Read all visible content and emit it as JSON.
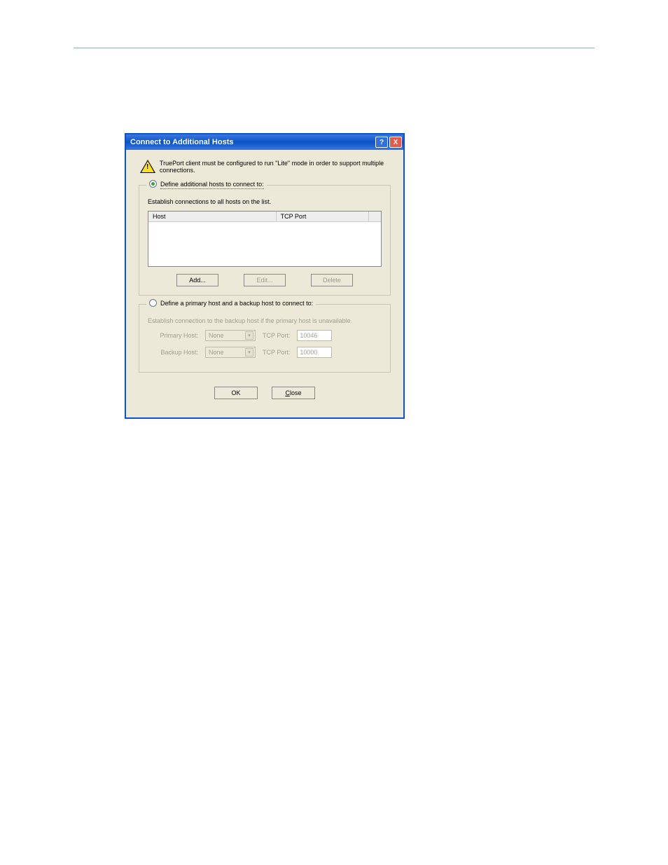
{
  "dialog": {
    "title": "Connect to Additional Hosts",
    "warning": "TruePort client must be configured to run \"Lite\" mode in order to support multiple connections."
  },
  "section1": {
    "radio_label": "Define additional hosts to connect to:",
    "subtext": "Establish connections to all hosts on the list.",
    "col_host": "Host",
    "col_tcp": "TCP Port",
    "btn_add": "Add...",
    "btn_edit": "Edit...",
    "btn_delete": "Delete"
  },
  "section2": {
    "radio_label": "Define a primary host and a backup host to connect to:",
    "subtext": "Establish connection to the backup host if the primary host is unavailable.",
    "primary_label": "Primary Host:",
    "backup_label": "Backup Host:",
    "primary_value": "None",
    "backup_value": "None",
    "tcp_label": "TCP Port:",
    "tcp_primary": "10046",
    "tcp_backup": "10000"
  },
  "footer": {
    "ok": "OK",
    "close": "Close"
  }
}
